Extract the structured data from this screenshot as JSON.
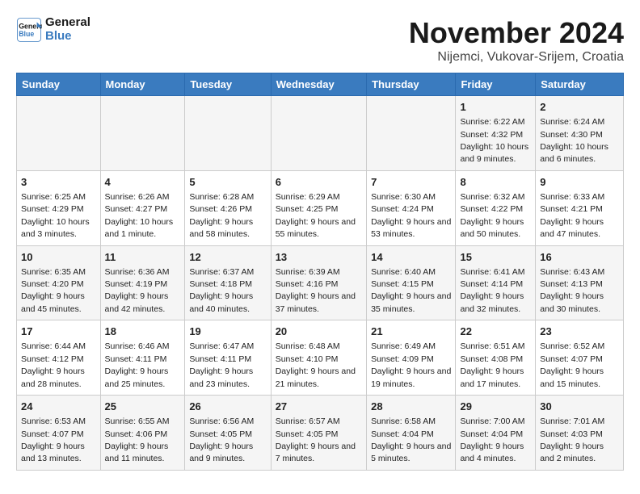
{
  "header": {
    "logo_line1": "General",
    "logo_line2": "Blue",
    "title": "November 2024",
    "subtitle": "Nijemci, Vukovar-Srijem, Croatia"
  },
  "columns": [
    "Sunday",
    "Monday",
    "Tuesday",
    "Wednesday",
    "Thursday",
    "Friday",
    "Saturday"
  ],
  "weeks": [
    [
      {
        "day": "",
        "info": ""
      },
      {
        "day": "",
        "info": ""
      },
      {
        "day": "",
        "info": ""
      },
      {
        "day": "",
        "info": ""
      },
      {
        "day": "",
        "info": ""
      },
      {
        "day": "1",
        "info": "Sunrise: 6:22 AM\nSunset: 4:32 PM\nDaylight: 10 hours and 9 minutes."
      },
      {
        "day": "2",
        "info": "Sunrise: 6:24 AM\nSunset: 4:30 PM\nDaylight: 10 hours and 6 minutes."
      }
    ],
    [
      {
        "day": "3",
        "info": "Sunrise: 6:25 AM\nSunset: 4:29 PM\nDaylight: 10 hours and 3 minutes."
      },
      {
        "day": "4",
        "info": "Sunrise: 6:26 AM\nSunset: 4:27 PM\nDaylight: 10 hours and 1 minute."
      },
      {
        "day": "5",
        "info": "Sunrise: 6:28 AM\nSunset: 4:26 PM\nDaylight: 9 hours and 58 minutes."
      },
      {
        "day": "6",
        "info": "Sunrise: 6:29 AM\nSunset: 4:25 PM\nDaylight: 9 hours and 55 minutes."
      },
      {
        "day": "7",
        "info": "Sunrise: 6:30 AM\nSunset: 4:24 PM\nDaylight: 9 hours and 53 minutes."
      },
      {
        "day": "8",
        "info": "Sunrise: 6:32 AM\nSunset: 4:22 PM\nDaylight: 9 hours and 50 minutes."
      },
      {
        "day": "9",
        "info": "Sunrise: 6:33 AM\nSunset: 4:21 PM\nDaylight: 9 hours and 47 minutes."
      }
    ],
    [
      {
        "day": "10",
        "info": "Sunrise: 6:35 AM\nSunset: 4:20 PM\nDaylight: 9 hours and 45 minutes."
      },
      {
        "day": "11",
        "info": "Sunrise: 6:36 AM\nSunset: 4:19 PM\nDaylight: 9 hours and 42 minutes."
      },
      {
        "day": "12",
        "info": "Sunrise: 6:37 AM\nSunset: 4:18 PM\nDaylight: 9 hours and 40 minutes."
      },
      {
        "day": "13",
        "info": "Sunrise: 6:39 AM\nSunset: 4:16 PM\nDaylight: 9 hours and 37 minutes."
      },
      {
        "day": "14",
        "info": "Sunrise: 6:40 AM\nSunset: 4:15 PM\nDaylight: 9 hours and 35 minutes."
      },
      {
        "day": "15",
        "info": "Sunrise: 6:41 AM\nSunset: 4:14 PM\nDaylight: 9 hours and 32 minutes."
      },
      {
        "day": "16",
        "info": "Sunrise: 6:43 AM\nSunset: 4:13 PM\nDaylight: 9 hours and 30 minutes."
      }
    ],
    [
      {
        "day": "17",
        "info": "Sunrise: 6:44 AM\nSunset: 4:12 PM\nDaylight: 9 hours and 28 minutes."
      },
      {
        "day": "18",
        "info": "Sunrise: 6:46 AM\nSunset: 4:11 PM\nDaylight: 9 hours and 25 minutes."
      },
      {
        "day": "19",
        "info": "Sunrise: 6:47 AM\nSunset: 4:11 PM\nDaylight: 9 hours and 23 minutes."
      },
      {
        "day": "20",
        "info": "Sunrise: 6:48 AM\nSunset: 4:10 PM\nDaylight: 9 hours and 21 minutes."
      },
      {
        "day": "21",
        "info": "Sunrise: 6:49 AM\nSunset: 4:09 PM\nDaylight: 9 hours and 19 minutes."
      },
      {
        "day": "22",
        "info": "Sunrise: 6:51 AM\nSunset: 4:08 PM\nDaylight: 9 hours and 17 minutes."
      },
      {
        "day": "23",
        "info": "Sunrise: 6:52 AM\nSunset: 4:07 PM\nDaylight: 9 hours and 15 minutes."
      }
    ],
    [
      {
        "day": "24",
        "info": "Sunrise: 6:53 AM\nSunset: 4:07 PM\nDaylight: 9 hours and 13 minutes."
      },
      {
        "day": "25",
        "info": "Sunrise: 6:55 AM\nSunset: 4:06 PM\nDaylight: 9 hours and 11 minutes."
      },
      {
        "day": "26",
        "info": "Sunrise: 6:56 AM\nSunset: 4:05 PM\nDaylight: 9 hours and 9 minutes."
      },
      {
        "day": "27",
        "info": "Sunrise: 6:57 AM\nSunset: 4:05 PM\nDaylight: 9 hours and 7 minutes."
      },
      {
        "day": "28",
        "info": "Sunrise: 6:58 AM\nSunset: 4:04 PM\nDaylight: 9 hours and 5 minutes."
      },
      {
        "day": "29",
        "info": "Sunrise: 7:00 AM\nSunset: 4:04 PM\nDaylight: 9 hours and 4 minutes."
      },
      {
        "day": "30",
        "info": "Sunrise: 7:01 AM\nSunset: 4:03 PM\nDaylight: 9 hours and 2 minutes."
      }
    ]
  ]
}
